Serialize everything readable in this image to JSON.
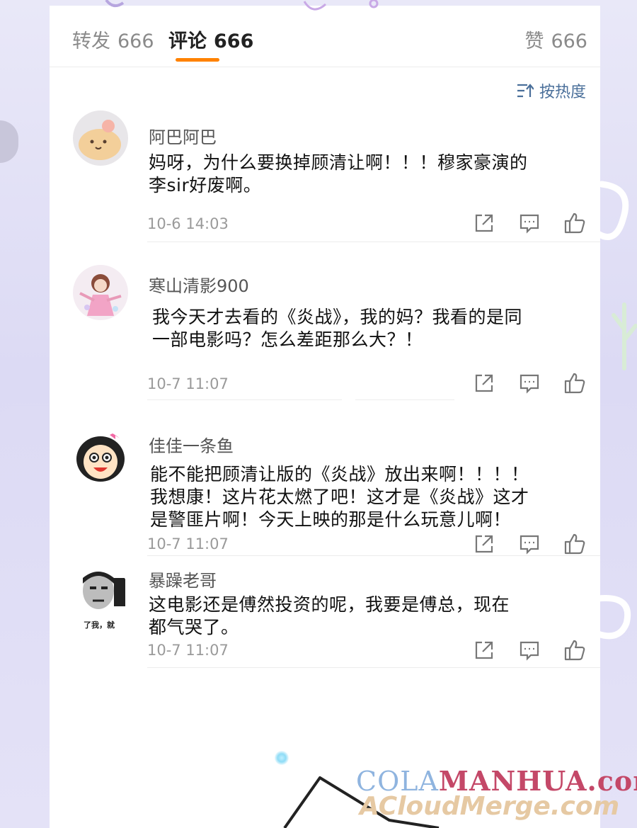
{
  "tabs": {
    "repost_label": "转发",
    "repost_count": "666",
    "comment_label": "评论",
    "comment_count": "666",
    "like_label": "赞",
    "like_count": "666"
  },
  "sort_label": "按热度",
  "comments": [
    {
      "name": "阿巴阿巴",
      "lines": [
        "妈呀，为什么要换掉顾清让啊！！！穆家豪演的",
        "李sir好废啊。"
      ],
      "time": "10-6 14:03"
    },
    {
      "name": "寒山清影900",
      "lines": [
        "我今天才去看的《炎战》，我的妈？我看的是同",
        "一部电影吗？怎么差距那么大？！"
      ],
      "time": "10-7 11:07"
    },
    {
      "name": "佳佳一条鱼",
      "lines": [
        "能不能把顾清让版的《炎战》放出来啊！！！！",
        "我想康！这片花太燃了吧！这才是《炎战》这才",
        "是警匪片啊！今天上映的那是什么玩意儿啊！"
      ],
      "time": "10-7 11:07"
    },
    {
      "name": "暴躁老哥",
      "lines": [
        "这电影还是傅然投资的呢，我要是傅总，现在",
        "都气哭了。"
      ],
      "time": "10-7 11:07",
      "avatar_caption": "了我，就"
    }
  ],
  "watermark": {
    "line1_a": "COLA",
    "line1_b": "MANHUA.com",
    "line2": "ACloudMerge.com"
  },
  "icons": [
    "sort-icon",
    "share-icon",
    "reply-icon",
    "like-icon"
  ],
  "colors": {
    "accent": "#ff8200",
    "link": "#4a6f9a",
    "muted": "#9a9a9a"
  }
}
